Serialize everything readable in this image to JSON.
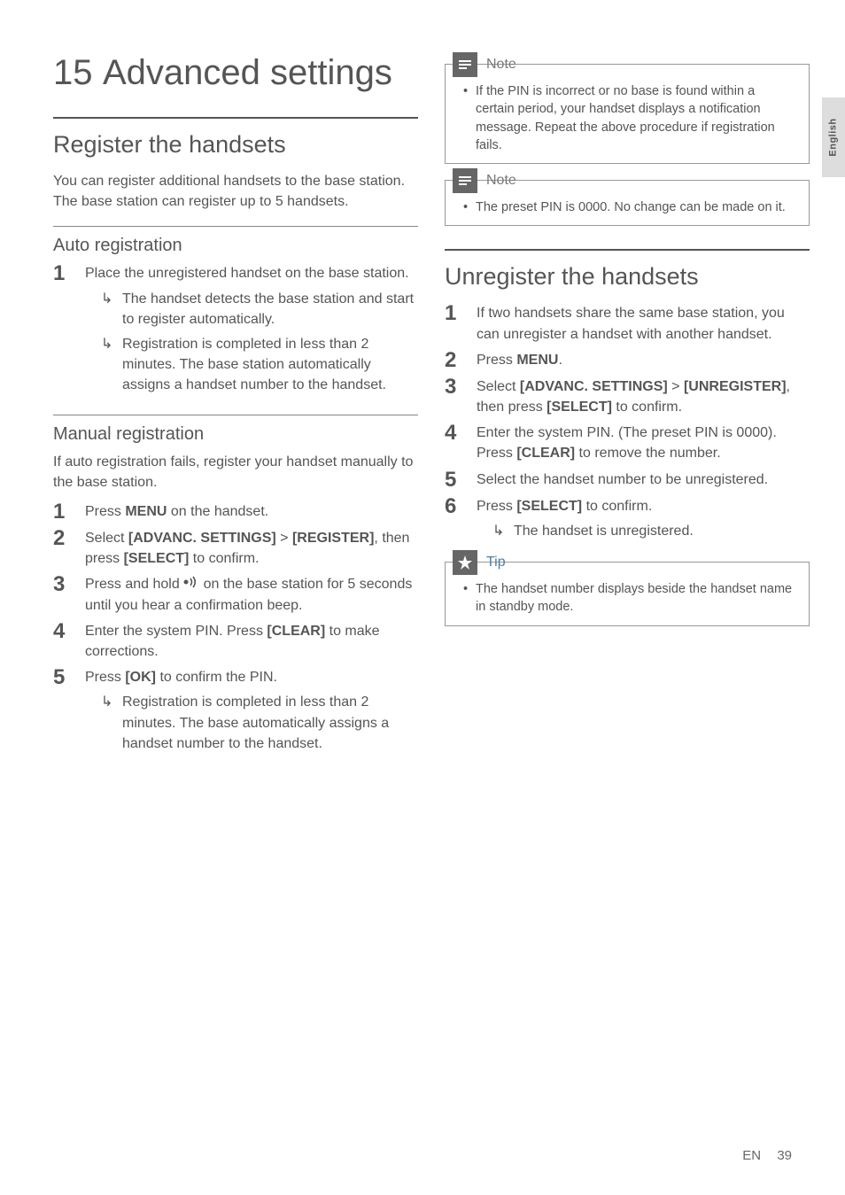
{
  "sideTab": "English",
  "chapter": {
    "num": "15",
    "title": "Advanced settings"
  },
  "left": {
    "h2": "Register the handsets",
    "intro": "You can register additional handsets to the base station. The base station can register up to 5 handsets.",
    "auto": {
      "h3": "Auto registration",
      "step1": "Place the unregistered handset on the base station.",
      "r1": "The handset detects the base station and start to register automatically.",
      "r2": "Registration is completed in less than 2 minutes. The base station automatically assigns a handset number to the handset."
    },
    "manual": {
      "h3": "Manual registration",
      "intro": "If auto registration fails, register your handset manually to the base station.",
      "s1a": "Press ",
      "s1b": "MENU",
      "s1c": " on the handset.",
      "s2a": "Select ",
      "s2b": "[ADVANC. SETTINGS]",
      "s2c": " > ",
      "s2d": "[REGISTER]",
      "s2e": ", then press ",
      "s2f": "[SELECT]",
      "s2g": " to confirm.",
      "s3a": "Press and hold ",
      "s3b": " on the base station for 5 seconds until you hear a confirmation beep.",
      "s4a": "Enter the system PIN. Press ",
      "s4b": "[CLEAR]",
      "s4c": " to make corrections.",
      "s5a": "Press ",
      "s5b": "[OK]",
      "s5c": " to confirm the PIN.",
      "s5r": "Registration is completed in less than 2 minutes. The base automatically assigns a handset number to the handset."
    }
  },
  "right": {
    "note1": {
      "label": "Note",
      "text": "If the PIN is incorrect or no base is found within a certain period, your handset displays a notification message. Repeat the above procedure if registration fails."
    },
    "note2": {
      "label": "Note",
      "text": "The preset PIN is 0000. No change can be made on it."
    },
    "h2": "Unregister the handsets",
    "s1": "If two handsets share the same base station, you can unregister a handset with another handset.",
    "s2a": "Press ",
    "s2b": "MENU",
    "s2c": ".",
    "s3a": "Select ",
    "s3b": "[ADVANC. SETTINGS]",
    "s3c": " > ",
    "s3d": "[UNREGISTER]",
    "s3e": ", then press ",
    "s3f": "[SELECT]",
    "s3g": " to confirm.",
    "s4a": "Enter the system PIN. (The preset PIN is 0000). Press ",
    "s4b": "[CLEAR]",
    "s4c": " to remove the number.",
    "s5": "Select the handset number to be unregistered.",
    "s6a": "Press ",
    "s6b": "[SELECT]",
    "s6c": " to confirm.",
    "s6r": "The handset is unregistered.",
    "tip": {
      "label": "Tip",
      "text": "The handset number displays beside the handset name in standby mode."
    }
  },
  "footer": {
    "lang": "EN",
    "page": "39"
  }
}
